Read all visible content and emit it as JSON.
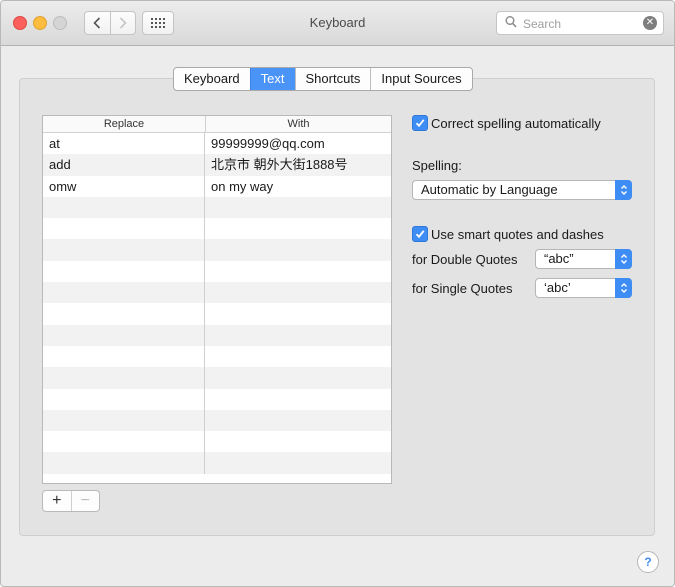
{
  "window": {
    "title": "Keyboard"
  },
  "search": {
    "placeholder": "Search"
  },
  "tabs": [
    {
      "label": "Keyboard",
      "selected": false
    },
    {
      "label": "Text",
      "selected": true
    },
    {
      "label": "Shortcuts",
      "selected": false
    },
    {
      "label": "Input Sources",
      "selected": false
    }
  ],
  "table": {
    "headers": {
      "replace": "Replace",
      "with": "With"
    },
    "rows": [
      {
        "replace": "at",
        "with": "99999999@qq.com"
      },
      {
        "replace": "add",
        "with": "北京市 朝外大街1888号"
      },
      {
        "replace": "omw",
        "with": "on my way"
      }
    ],
    "empty_rows": 13
  },
  "buttons": {
    "add": "+",
    "remove": "−"
  },
  "options": {
    "correct_spelling": {
      "label": "Correct spelling automatically",
      "checked": true
    },
    "spelling_label": "Spelling:",
    "spelling_value": "Automatic by Language",
    "smart_quotes": {
      "label": "Use smart quotes and dashes",
      "checked": true
    },
    "double_quotes_label": "for Double Quotes",
    "double_quotes_value": "“abc”",
    "single_quotes_label": "for Single Quotes",
    "single_quotes_value": "‘abc’"
  },
  "help": "?",
  "colors": {
    "accent": "#3d8df5",
    "tab_selected": "#4a93f7"
  }
}
